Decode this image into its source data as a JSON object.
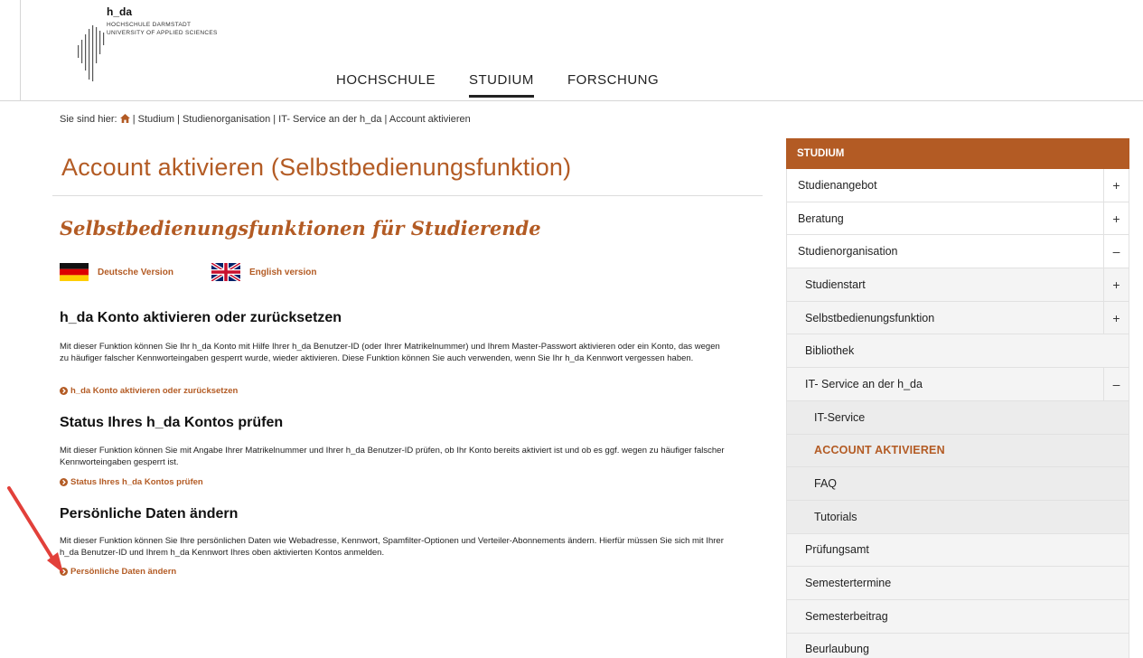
{
  "logo": {
    "name": "h_da",
    "line1": "HOCHSCHULE DARMSTADT",
    "line2": "UNIVERSITY OF APPLIED SCIENCES"
  },
  "nav": {
    "items": [
      {
        "label": "HOCHSCHULE",
        "active": false
      },
      {
        "label": "STUDIUM",
        "active": true
      },
      {
        "label": "FORSCHUNG",
        "active": false
      }
    ]
  },
  "breadcrumb": {
    "prefix": "Sie sind hier:",
    "home_icon": "home-icon",
    "trail": "| Studium | Studienorganisation | IT- Service an der h_da |",
    "current": "Account aktivieren"
  },
  "main": {
    "title": "Account aktivieren (Selbstbedienungsfunktion)",
    "subtitle": "Selbstbedienungsfunktionen für Studierende",
    "languages": [
      {
        "label": "Deutsche Version",
        "icon": "german-flag-icon"
      },
      {
        "label": "English version",
        "icon": "uk-flag-icon"
      }
    ],
    "sections": [
      {
        "title": "h_da Konto aktivieren oder zurücksetzen",
        "text": "Mit dieser Funktion können Sie Ihr h_da Konto mit Hilfe Ihrer h_da Benutzer-ID (oder Ihrer Matrikelnummer) und Ihrem Master-Passwort aktivieren oder ein Konto, das wegen zu häufiger falscher Kennworteingaben gesperrt wurde, wieder aktivieren. Diese Funktion können Sie auch verwenden, wenn Sie Ihr h_da Kennwort vergessen haben.",
        "link": "h_da Konto aktivieren oder zurücksetzen"
      },
      {
        "title": "Status Ihres h_da Kontos prüfen",
        "text": "Mit dieser Funktion können Sie mit Angabe Ihrer Matrikelnummer und Ihrer h_da Benutzer-ID prüfen, ob Ihr Konto bereits aktiviert ist und ob es ggf. wegen zu häufiger falscher Kennworteingaben gesperrt ist.",
        "link": "Status Ihres h_da Kontos prüfen"
      },
      {
        "title": "Persönliche Daten ändern",
        "text": "Mit dieser Funktion können Sie Ihre persönlichen Daten wie Webadresse, Kennwort, Spamfilter-Optionen und Verteiler-Abonnements ändern. Hierfür müssen Sie sich mit Ihrer h_da Benutzer-ID und Ihrem h_da Kennwort Ihres oben aktivierten Kontos anmelden.",
        "link": "Persönliche Daten ändern"
      }
    ]
  },
  "sidebar": {
    "header": "STUDIUM",
    "items": [
      {
        "label": "Studienangebot",
        "toggle": "+"
      },
      {
        "label": "Beratung",
        "toggle": "+"
      },
      {
        "label": "Studienorganisation",
        "toggle": "–"
      },
      {
        "label": "Studienstart",
        "toggle": "+"
      },
      {
        "label": "Selbstbedienungsfunktion",
        "toggle": "+"
      },
      {
        "label": "Bibliothek",
        "toggle": ""
      },
      {
        "label": "IT- Service an der h_da",
        "toggle": "–"
      },
      {
        "label": "IT-Service",
        "toggle": ""
      },
      {
        "label": "ACCOUNT AKTIVIEREN",
        "toggle": ""
      },
      {
        "label": "FAQ",
        "toggle": ""
      },
      {
        "label": "Tutorials",
        "toggle": ""
      },
      {
        "label": "Prüfungsamt",
        "toggle": ""
      },
      {
        "label": "Semestertermine",
        "toggle": ""
      },
      {
        "label": "Semesterbeitrag",
        "toggle": ""
      },
      {
        "label": "Beurlaubung",
        "toggle": ""
      }
    ]
  },
  "colors": {
    "accent": "#b35b24",
    "annotation_arrow": "#e2403a"
  }
}
